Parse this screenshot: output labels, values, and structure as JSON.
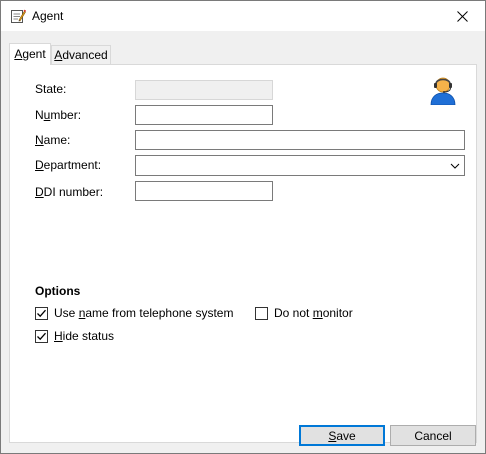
{
  "window": {
    "title": "Agent",
    "title_icon": "notepad-pencil-icon",
    "close_icon": "close-icon"
  },
  "tabs": [
    {
      "label_underline": "A",
      "label_rest": "gent",
      "selected": true
    },
    {
      "label_underline": "A",
      "label_rest": "dvanced",
      "selected": false
    }
  ],
  "form": {
    "state": {
      "label": "State:",
      "value": "",
      "enabled": false
    },
    "number": {
      "label_underline": "u",
      "label_pre": "N",
      "label_post": "mber:",
      "value": ""
    },
    "name": {
      "label_underline": "N",
      "label_pre": "",
      "label_post": "ame:",
      "value": ""
    },
    "department": {
      "label_underline": "D",
      "label_pre": "",
      "label_post": "epartment:",
      "value": ""
    },
    "ddi": {
      "label_underline": "D",
      "label_pre": "",
      "label_post": "DI number:",
      "value": ""
    },
    "avatar_icon": "agent-headset-icon"
  },
  "options": {
    "title": "Options",
    "use_name": {
      "label_pre": "Use ",
      "label_underline": "n",
      "label_post": "ame from telephone system",
      "checked": true
    },
    "do_not_monitor": {
      "label_pre": "Do not ",
      "label_underline": "m",
      "label_post": "onitor",
      "checked": false
    },
    "hide_status": {
      "label_pre": "",
      "label_underline": "H",
      "label_post": "ide status",
      "checked": true
    }
  },
  "buttons": {
    "save": {
      "label_underline": "S",
      "label_rest": "ave"
    },
    "cancel": {
      "label": "Cancel"
    }
  },
  "colors": {
    "accent": "#0078d7",
    "avatar_shirt": "#1f6fd6",
    "avatar_skin": "#f5b24a"
  }
}
